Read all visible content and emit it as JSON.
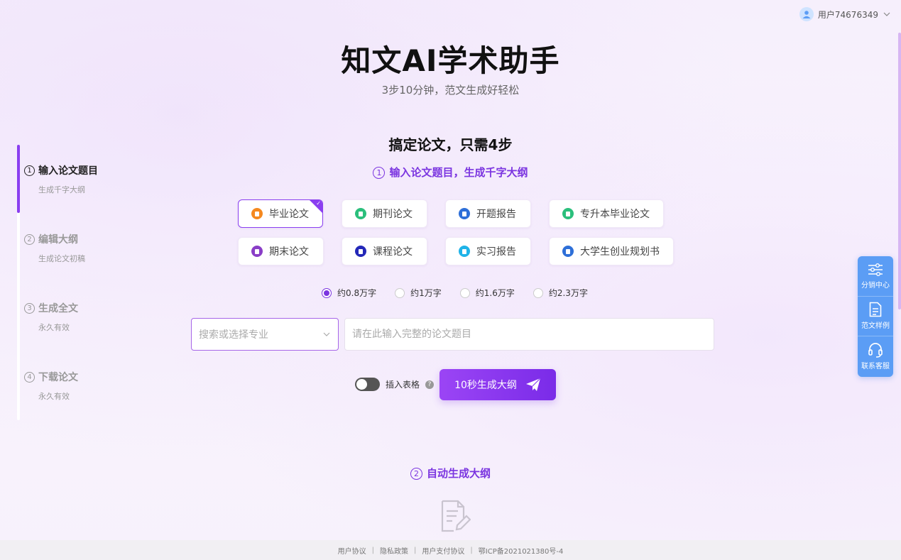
{
  "user": {
    "name": "用户74676349"
  },
  "hero": {
    "title": "知文AI学术助手",
    "subtitle": "3步10分钟，范文生成好轻松"
  },
  "steps": [
    {
      "num": "1",
      "title": "输入论文题目",
      "desc": "生成千字大纲"
    },
    {
      "num": "2",
      "title": "编辑大纲",
      "desc": "生成论文初稿"
    },
    {
      "num": "3",
      "title": "生成全文",
      "desc": "永久有效"
    },
    {
      "num": "4",
      "title": "下载论文",
      "desc": "永久有效"
    }
  ],
  "main": {
    "section_title": "搞定论文，只需4步",
    "step1_num": "1",
    "step1_heading": "输入论文题目，生成千字大纲",
    "types": [
      {
        "label": "毕业论文",
        "color": "#f5891f"
      },
      {
        "label": "期刊论文",
        "color": "#2bbf7c"
      },
      {
        "label": "开题报告",
        "color": "#2e6fd8"
      },
      {
        "label": "专升本毕业论文",
        "color": "#2bbf7c"
      },
      {
        "label": "期末论文",
        "color": "#8a3ec7"
      },
      {
        "label": "课程论文",
        "color": "#2428b8"
      },
      {
        "label": "实习报告",
        "color": "#1fb3e8"
      },
      {
        "label": "大学生创业规划书",
        "color": "#2e6fd8"
      }
    ],
    "word_counts": [
      "约0.8万字",
      "约1万字",
      "约1.6万字",
      "约2.3万字"
    ],
    "major_placeholder": "搜索或选择专业",
    "topic_placeholder": "请在此输入完整的论文题目",
    "insert_table_label": "插入表格",
    "generate_label": "10秒生成大纲",
    "step2_num": "2",
    "step2_heading": "自动生成大纲"
  },
  "side_panel": [
    {
      "label": "分销中心",
      "icon": "sliders-icon"
    },
    {
      "label": "范文样例",
      "icon": "document-icon"
    },
    {
      "label": "联系客服",
      "icon": "headset-icon"
    }
  ],
  "footer": {
    "links": [
      "用户协议",
      "隐私政策",
      "用户支付协议",
      "鄂ICP备2021021380号-4"
    ]
  },
  "colors": {
    "accent": "#7b35e0",
    "side_panel": "#5b9df5"
  }
}
